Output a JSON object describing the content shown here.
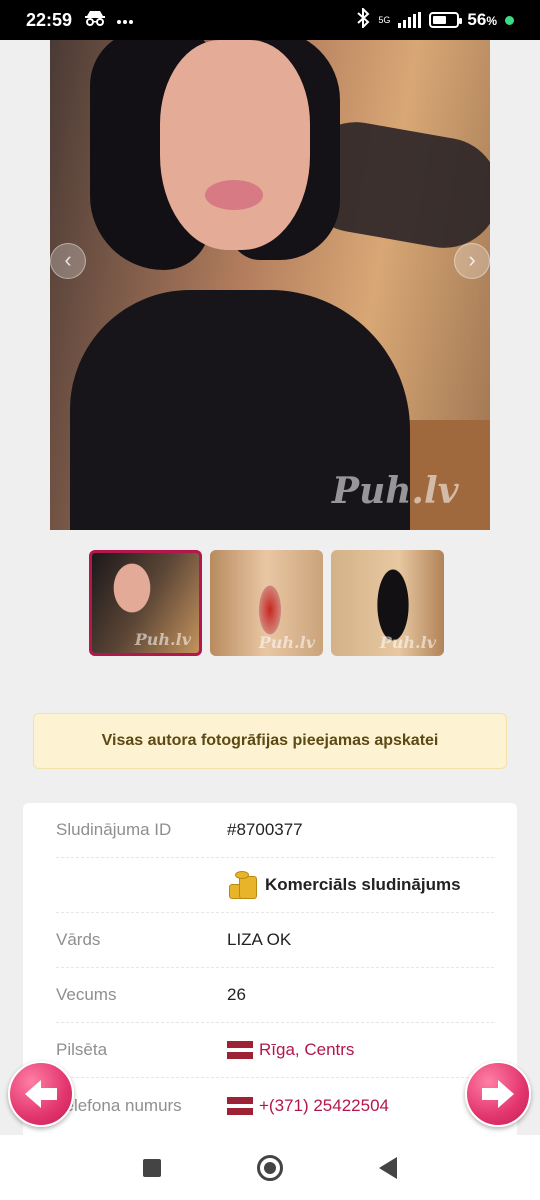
{
  "status_bar": {
    "time": "22:59",
    "incognito_icon": "incognito-icon",
    "more_icon": "more-dots-icon",
    "bluetooth_icon": "bluetooth-icon",
    "network": "5G",
    "battery_percent": "56",
    "battery_unit": "%"
  },
  "gallery": {
    "watermark": "Puh.lv",
    "prev_icon": "chevron-left-icon",
    "next_icon": "chevron-right-icon",
    "thumbnails": [
      {
        "watermark": "Puh.lv",
        "active": true
      },
      {
        "watermark": "Puh.lv",
        "active": false
      },
      {
        "watermark": "Puh.lv",
        "active": false
      }
    ]
  },
  "notice": {
    "text": "Visas autora fotogrāfijas pieejamas apskatei"
  },
  "details": {
    "id_label": "Sludinājuma ID",
    "id_value": "#8700377",
    "commercial_label": "Komerciāls sludinājums",
    "name_label": "Vārds",
    "name_value": "LIZA OK",
    "age_label": "Vecums",
    "age_value": "26",
    "city_label": "Pilsēta",
    "city_value": "Rīga, Centrs",
    "phone_label": "Telefona numurs",
    "phone_value": "+(371) 25422504"
  },
  "navigation": {
    "prev_arrow": "arrow-left-icon",
    "next_arrow": "arrow-right-icon"
  },
  "colors": {
    "accent": "#b3174e",
    "notice_bg": "#fdf3d2"
  }
}
